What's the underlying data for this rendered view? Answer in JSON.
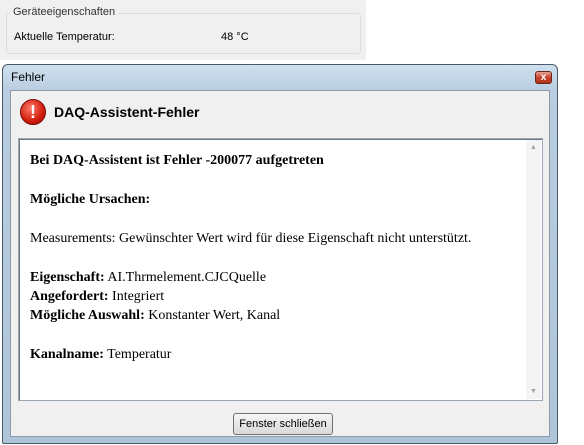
{
  "device_properties": {
    "group_title": "Geräteeigenschaften",
    "temperature_label": "Aktuelle Temperatur:",
    "temperature_value": "48 °C"
  },
  "dialog": {
    "window_title": "Fehler",
    "close_glyph": "x",
    "header_title": "DAQ-Assistent-Fehler",
    "error_icon_glyph": "!",
    "message": {
      "headline": "Bei DAQ-Assistent ist Fehler -200077 aufgetreten",
      "causes_heading": "Mögliche Ursachen:",
      "description": "Measurements: Gewünschter Wert wird für diese Eigenschaft nicht unterstützt.",
      "property_label": "Eigenschaft:",
      "property_value": "AI.Thrmelement.CJCQuelle",
      "requested_label": "Angefordert:",
      "requested_value": "Integriert",
      "options_label": "Mögliche Auswahl:",
      "options_value": "Konstanter Wert, Kanal",
      "channel_label": "Kanalname:",
      "channel_value": "Temperatur"
    },
    "scroll_up_glyph": "▲",
    "scroll_down_glyph": "▼",
    "close_button_label": "Fenster schließen"
  }
}
